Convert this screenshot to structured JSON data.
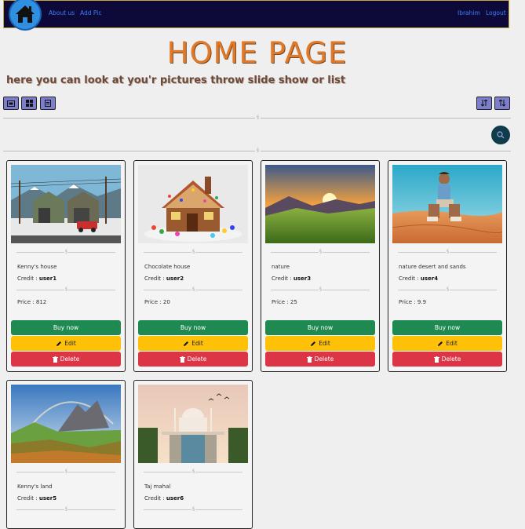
{
  "nav": {
    "home_icon": "home-icon",
    "about": "About us",
    "add_pic": "Add Pic",
    "user": "Ibrahim",
    "logout": "Logout"
  },
  "header": {
    "title": "HOME PAGE",
    "subtitle": "here you can look at you'r pictures throw slide show or list"
  },
  "toolbar": {
    "slideshow_icon": "slideshow-icon",
    "grid_icon": "grid-icon",
    "list_icon": "list-icon",
    "sort_desc_icon": "sort-desc-icon",
    "sort_asc_icon": "sort-asc-icon",
    "search_icon": "search-icon"
  },
  "divider_glyph": "§",
  "labels": {
    "credit": "Credit : ",
    "price": "Price : ",
    "buy": "Buy now",
    "edit": "Edit",
    "delete": "Delete"
  },
  "cards": [
    {
      "name": "Kenny's house",
      "user": "user1",
      "price": "812"
    },
    {
      "name": "Chocolate house",
      "user": "user2",
      "price": "20"
    },
    {
      "name": "nature",
      "user": "user3",
      "price": "25"
    },
    {
      "name": "nature desert and sands",
      "user": "user4",
      "price": "9.9"
    },
    {
      "name": "Kenny's land",
      "user": "user5",
      "price": ""
    },
    {
      "name": "Taj mahal",
      "user": "user6",
      "price": ""
    }
  ],
  "colors": {
    "nav_bg": "#0d0a3a",
    "title": "#e07a2a",
    "buy": "#1e8a52",
    "edit": "#ffc107",
    "delete": "#dc3545",
    "toolbar_btn": "#7d7fcc"
  }
}
